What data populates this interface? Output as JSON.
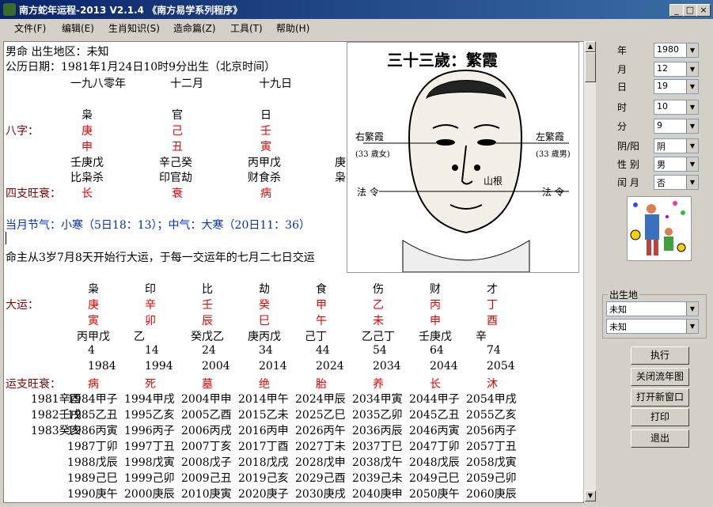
{
  "window": {
    "title": "南方蛇年运程-2013   V2.1.4  《南方易学系列程序》",
    "controls": [
      "_",
      "□",
      "×"
    ]
  },
  "menu": [
    "文件(F)",
    "编辑(E)",
    "生肖知识(S)",
    "造命篇(Z)",
    "工具(T)",
    "帮助(H)"
  ],
  "doc": {
    "line1": "男命   出生地区：未知",
    "line2": "公历日期：1981年1月24日10时9分出生（北京时间）",
    "line3": [
      "一九八零年",
      "十二月",
      "十九日"
    ],
    "gods": [
      "枭",
      "官",
      "日"
    ],
    "bazi_label": "八字：",
    "stems": [
      "庚",
      "己",
      "壬"
    ],
    "branches": [
      "申",
      "丑",
      "寅"
    ],
    "hidden": [
      "壬庚戊",
      "辛己癸",
      "丙甲戊",
      "庚"
    ],
    "hidden_gods": [
      "比枭杀",
      "印官劫",
      "财食杀",
      "枭"
    ],
    "wangshuai_label": "四支旺衰：",
    "wangshuai": [
      "长",
      "衰",
      "病"
    ],
    "jieqi": "当月节气：小寒（5日18：13）；中气：大寒（20日11：36）",
    "dayun_start": "命主从3岁7月8天开始行大运，于每一交运年的七月二七日交运",
    "dayun_gods": [
      "枭",
      "印",
      "比",
      "劫",
      "食",
      "伤",
      "财",
      "才"
    ],
    "dayun_label": "大运：",
    "dayun_stems": [
      "庚",
      "辛",
      "壬",
      "癸",
      "甲",
      "乙",
      "丙",
      "丁"
    ],
    "dayun_branches": [
      "寅",
      "卯",
      "辰",
      "巳",
      "午",
      "未",
      "申",
      "酉"
    ],
    "dayun_hidden": [
      "丙甲戊",
      "乙",
      "癸戊乙",
      "庚丙戊",
      "己丁",
      "乙己丁",
      "壬庚戊",
      "辛"
    ],
    "dayun_ages": [
      "4",
      "14",
      "24",
      "34",
      "44",
      "54",
      "64",
      "74"
    ],
    "dayun_years": [
      "1984",
      "1994",
      "2004",
      "2014",
      "2024",
      "2034",
      "2044",
      "2054"
    ],
    "yunzhi_label": "运支旺衰：",
    "yunzhi": [
      "病",
      "死",
      "墓",
      "绝",
      "胎",
      "养",
      "长",
      "沐"
    ],
    "liunian_first": [
      "1981辛酉",
      "1982壬戌",
      "1983癸亥"
    ],
    "liunian": [
      [
        "1984甲子",
        "1994甲戌",
        "2004甲申",
        "2014甲午",
        "2024甲辰",
        "2034甲寅",
        "2044甲子",
        "2054甲戌"
      ],
      [
        "1985乙丑",
        "1995乙亥",
        "2005乙酉",
        "2015乙未",
        "2025乙巳",
        "2035乙卯",
        "2045乙丑",
        "2055乙亥"
      ],
      [
        "1986丙寅",
        "1996丙子",
        "2006丙戌",
        "2016丙申",
        "2026丙午",
        "2036丙辰",
        "2046丙寅",
        "2056丙子"
      ],
      [
        "1987丁卯",
        "1997丁丑",
        "2007丁亥",
        "2017丁酉",
        "2027丁未",
        "2037丁巳",
        "2047丁卯",
        "2057丁丑"
      ],
      [
        "1988戊辰",
        "1998戊寅",
        "2008戊子",
        "2018戊戌",
        "2028戊申",
        "2038戊午",
        "2048戊辰",
        "2058戊寅"
      ],
      [
        "1989己巳",
        "1999己卯",
        "2009己丑",
        "2019己亥",
        "2029己酉",
        "2039己未",
        "2049己巳",
        "2059己卯"
      ],
      [
        "1990庚午",
        "2000庚辰",
        "2010庚寅",
        "2020庚子",
        "2030庚戌",
        "2040庚申",
        "2050庚午",
        "2060庚辰"
      ]
    ]
  },
  "face": {
    "title": "三十三歲：繁霞",
    "right_label": "右繁霞",
    "right_age": "(33 歲女)",
    "left_label": "左繁霞",
    "left_age": "(33 歲男)",
    "shan": "山根",
    "fa1": "法 令",
    "fa2": "法 令"
  },
  "panel": {
    "year_label": "年",
    "year": "1980",
    "month_label": "月",
    "month": "12",
    "day_label": "日",
    "day": "19",
    "hour_label": "时",
    "hour": "10",
    "min_label": "分",
    "min": "9",
    "yinyang_label": "阴/阳",
    "yinyang": "阴",
    "gender_label": "性 别",
    "gender": "男",
    "leap_label": "闰 月",
    "leap": "否",
    "birthplace_label": "出生地",
    "place1": "未知",
    "place2": "未知",
    "buttons": [
      "执行",
      "关闭流年图",
      "打开新窗口",
      "打印",
      "退出"
    ]
  }
}
